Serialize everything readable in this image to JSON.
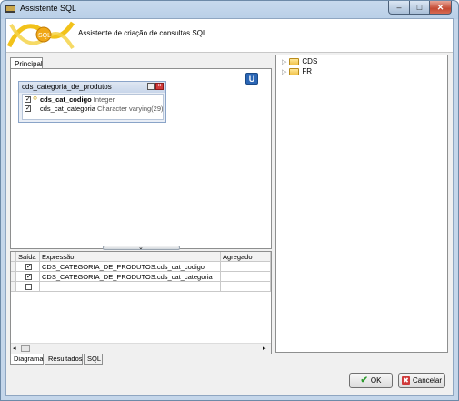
{
  "window": {
    "title": "Assistente SQL"
  },
  "header": {
    "description": "Assistente de criação de consultas SQL."
  },
  "tabs_top": [
    {
      "label": "Principal"
    }
  ],
  "table": {
    "name": "cds_categoria_de_produtos",
    "fields": [
      {
        "name": "cds_cat_codigo",
        "type": "Integer",
        "checked": true,
        "key": true
      },
      {
        "name": "cds_cat_categoria",
        "type": "Character varying(29)",
        "checked": true,
        "key": false
      }
    ]
  },
  "u_button": {
    "label": "U"
  },
  "grid": {
    "columns": [
      "Saída",
      "Expressão",
      "Agregado"
    ],
    "rows": [
      {
        "saida": true,
        "expressao": "CDS_CATEGORIA_DE_PRODUTOS.cds_cat_codigo",
        "agregado": ""
      },
      {
        "saida": true,
        "expressao": "CDS_CATEGORIA_DE_PRODUTOS.cds_cat_categoria",
        "agregado": ""
      },
      {
        "saida": false,
        "expressao": "",
        "agregado": ""
      }
    ]
  },
  "tabs_bottom": [
    {
      "label": "Diagrama"
    },
    {
      "label": "Resultados"
    },
    {
      "label": "SQL"
    }
  ],
  "tree": [
    {
      "label": "CDS"
    },
    {
      "label": "FR"
    }
  ],
  "buttons": {
    "ok": "OK",
    "cancel": "Cancelar"
  },
  "colors": {
    "accent": "#2b66b5",
    "ok_green": "#2e9b2e",
    "cancel_red": "#d03a3a"
  }
}
